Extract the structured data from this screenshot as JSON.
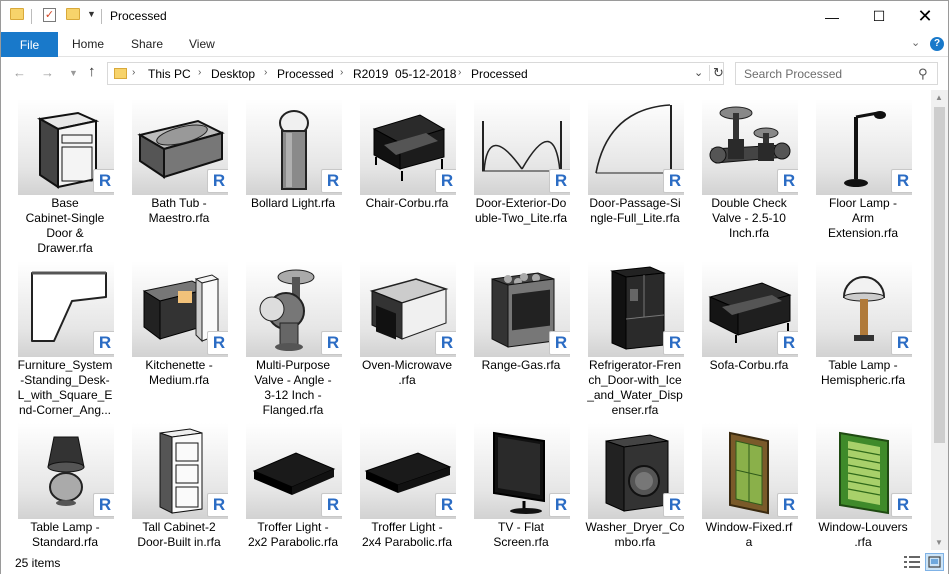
{
  "window": {
    "title": "Processed"
  },
  "ribbon": {
    "tabs": [
      "File",
      "Home",
      "Share",
      "View"
    ]
  },
  "address": {
    "crumbs": [
      "This PC",
      "Desktop",
      "Processed",
      "R2019  05-12-2018",
      "Processed"
    ]
  },
  "search": {
    "placeholder": "Search Processed"
  },
  "badge": "R",
  "items": [
    {
      "label": "Base Cabinet-Single Door & Drawer.rfa",
      "lines": [
        "Base",
        "Cabinet-Single",
        "Door &",
        "Drawer.rfa"
      ],
      "icon": "base-cabinet"
    },
    {
      "label": "Bath Tub - Maestro.rfa",
      "lines": [
        "Bath Tub -",
        "Maestro.rfa"
      ],
      "icon": "bathtub"
    },
    {
      "label": "Bollard Light.rfa",
      "lines": [
        "Bollard Light.rfa"
      ],
      "icon": "bollard-light"
    },
    {
      "label": "Chair-Corbu.rfa",
      "lines": [
        "Chair-Corbu.rfa"
      ],
      "icon": "chair"
    },
    {
      "label": "Door-Exterior-Double-Two_Lite.rfa",
      "lines": [
        "Door-Exterior-Do",
        "uble-Two_Lite.rfa"
      ],
      "icon": "double-door"
    },
    {
      "label": "Door-Passage-Single-Full_Lite.rfa",
      "lines": [
        "Door-Passage-Si",
        "ngle-Full_Lite.rfa"
      ],
      "icon": "single-door"
    },
    {
      "label": "Double Check Valve - 2.5-10 Inch.rfa",
      "lines": [
        "Double Check",
        "Valve - 2.5-10",
        "Inch.rfa"
      ],
      "icon": "check-valve"
    },
    {
      "label": "Floor Lamp - Arm Extension.rfa",
      "lines": [
        "Floor Lamp -",
        "Arm",
        "Extension.rfa"
      ],
      "icon": "floor-lamp"
    },
    {
      "label": "Furniture_System-Standing_Desk-L_with_Square_End-Corner_Ang...",
      "lines": [
        "Furniture_System",
        "-Standing_Desk-",
        "L_with_Square_E",
        "nd-Corner_Ang..."
      ],
      "icon": "desk"
    },
    {
      "label": "Kitchenette - Medium.rfa",
      "lines": [
        "Kitchenette -",
        "Medium.rfa"
      ],
      "icon": "kitchenette"
    },
    {
      "label": "Multi-Purpose Valve - Angle - 3-12 Inch - Flanged.rfa",
      "lines": [
        "Multi-Purpose",
        "Valve - Angle -",
        "3-12 Inch -",
        "Flanged.rfa"
      ],
      "icon": "angle-valve"
    },
    {
      "label": "Oven-Microwave.rfa",
      "lines": [
        "Oven-Microwave",
        ".rfa"
      ],
      "icon": "microwave"
    },
    {
      "label": "Range-Gas.rfa",
      "lines": [
        "Range-Gas.rfa"
      ],
      "icon": "range"
    },
    {
      "label": "Refrigerator-French_Door-with_Ice_and_Water_Dispenser.rfa",
      "lines": [
        "Refrigerator-Fren",
        "ch_Door-with_Ice",
        "_and_Water_Disp",
        "enser.rfa"
      ],
      "icon": "refrigerator"
    },
    {
      "label": "Sofa-Corbu.rfa",
      "lines": [
        "Sofa-Corbu.rfa"
      ],
      "icon": "sofa"
    },
    {
      "label": "Table Lamp - Hemispheric.rfa",
      "lines": [
        "Table Lamp -",
        "Hemispheric.rfa"
      ],
      "icon": "table-lamp-hemi"
    },
    {
      "label": "Table Lamp - Standard.rfa",
      "lines": [
        "Table Lamp -",
        "Standard.rfa"
      ],
      "icon": "table-lamp"
    },
    {
      "label": "Tall Cabinet-2 Door-Built in.rfa",
      "lines": [
        "Tall Cabinet-2",
        "Door-Built in.rfa"
      ],
      "icon": "tall-cabinet"
    },
    {
      "label": "Troffer Light - 2x2 Parabolic.rfa",
      "lines": [
        "Troffer Light -",
        "2x2 Parabolic.rfa"
      ],
      "icon": "troffer-2x2"
    },
    {
      "label": "Troffer Light - 2x4 Parabolic.rfa",
      "lines": [
        "Troffer Light -",
        "2x4 Parabolic.rfa"
      ],
      "icon": "troffer-2x4"
    },
    {
      "label": "TV - Flat Screen.rfa",
      "lines": [
        "TV - Flat",
        "Screen.rfa"
      ],
      "icon": "tv"
    },
    {
      "label": "Washer_Dryer_Combo.rfa",
      "lines": [
        "Washer_Dryer_Co",
        "mbo.rfa"
      ],
      "icon": "washer"
    },
    {
      "label": "Window-Fixed.rfa",
      "lines": [
        "Window-Fixed.rf",
        "a"
      ],
      "icon": "window-fixed"
    },
    {
      "label": "Window-Louvers.rfa",
      "lines": [
        "Window-Louvers",
        ".rfa"
      ],
      "icon": "window-louvers"
    }
  ],
  "status": {
    "count": "25 items"
  }
}
